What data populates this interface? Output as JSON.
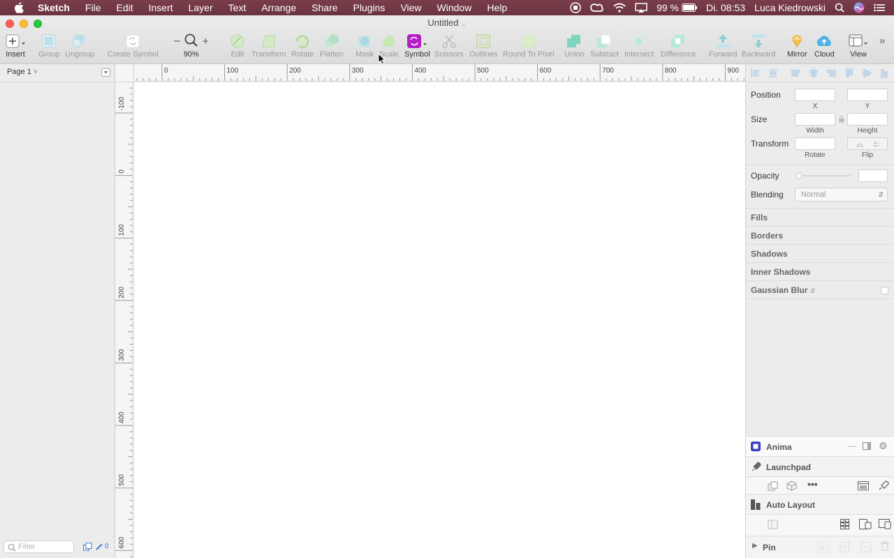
{
  "menubar": {
    "app_name": "Sketch",
    "items": [
      "File",
      "Edit",
      "Insert",
      "Layer",
      "Text",
      "Arrange",
      "Share",
      "Plugins",
      "View",
      "Window",
      "Help"
    ],
    "battery": "99 %",
    "clock": "Di. 08:53",
    "user": "Luca Kiedrowski"
  },
  "window": {
    "title": "Untitled"
  },
  "toolbar": {
    "insert": "Insert",
    "group": "Group",
    "ungroup": "Ungroup",
    "create_symbol": "Create Symbol",
    "zoom": "90%",
    "edit": "Edit",
    "transform": "Transform",
    "rotate": "Rotate",
    "flatten": "Flatten",
    "mask": "Mask",
    "scale": "Scale",
    "symbol": "Symbol",
    "scissors": "Scissors",
    "outlines": "Outlines",
    "round_to_pixel": "Round To Pixel",
    "union": "Union",
    "subtract": "Subtract",
    "intersect": "Intersect",
    "difference": "Difference",
    "forward": "Forward",
    "backward": "Backward",
    "mirror": "Mirror",
    "cloud": "Cloud",
    "view": "View"
  },
  "left_panel": {
    "page": "Page 1",
    "filter_placeholder": "Filter",
    "count": "0"
  },
  "rulers": {
    "horizontal": [
      "0",
      "100",
      "200",
      "300",
      "400",
      "500",
      "600",
      "700",
      "800",
      "900"
    ],
    "vertical": [
      "-100",
      "0",
      "100",
      "200",
      "300",
      "400",
      "500",
      "600"
    ]
  },
  "inspector": {
    "position": "Position",
    "x": "X",
    "y": "Y",
    "size": "Size",
    "width": "Width",
    "height": "Height",
    "transform": "Transform",
    "rotate": "Rotate",
    "flip": "Flip",
    "opacity": "Opacity",
    "blending": "Blending",
    "blending_value": "Normal",
    "fills": "Fills",
    "borders": "Borders",
    "shadows": "Shadows",
    "inner_shadows": "Inner Shadows",
    "gaussian_blur": "Gaussian Blur"
  },
  "plugins": {
    "anima": "Anima",
    "launchpad": "Launchpad",
    "auto_layout": "Auto Layout",
    "pin": "Pin"
  },
  "colors": {
    "menubar": "#6f3744",
    "symbol_accent": "#b41fc4",
    "boolean_green": "#7ed6c1"
  }
}
